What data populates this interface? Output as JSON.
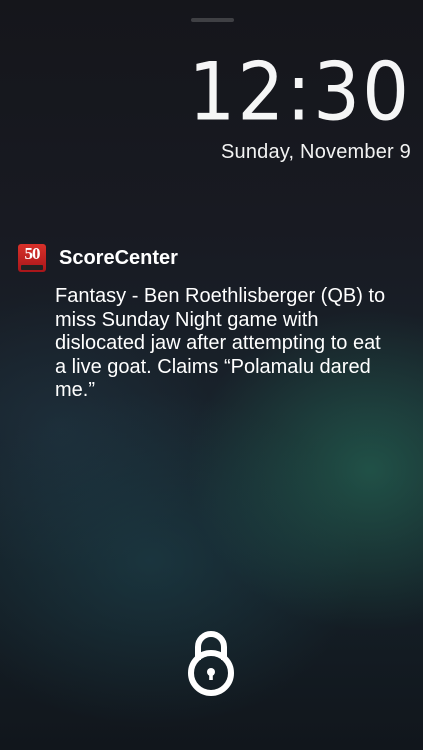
{
  "lockscreen": {
    "time": "12:30",
    "date": "Sunday, November 9"
  },
  "notification": {
    "app_icon": "50-app-icon",
    "app_icon_text": "50",
    "app_name": "ScoreCenter",
    "message": "Fantasy - Ben Roethlisberger (QB) to miss Sunday Night game with dislocated jaw after attempting to eat a live goat. Claims “Polamalu dared me.”"
  },
  "unlock": {
    "icon": "padlock-icon"
  },
  "colors": {
    "text": "#ffffff",
    "app_icon_red": "#c4231f",
    "background_dark": "#15161b",
    "background_glow": "#287862"
  }
}
